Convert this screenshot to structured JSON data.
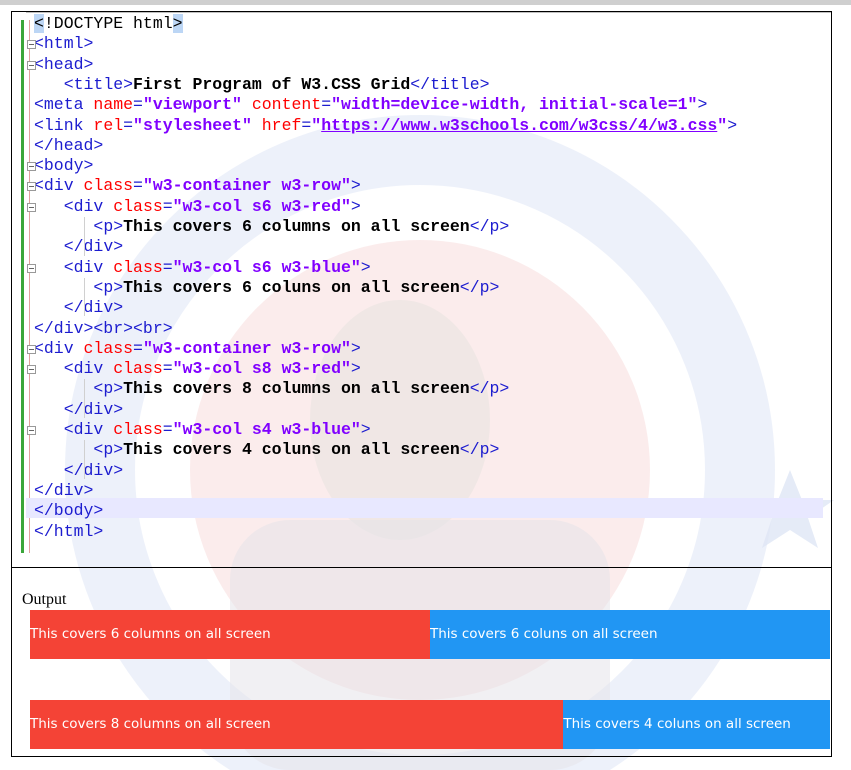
{
  "editor": {
    "lines": [
      {
        "kind": "doctype",
        "text": "<!DOCTYPE html>"
      },
      {
        "kind": "html_open",
        "text": "<html>"
      },
      {
        "kind": "head_open",
        "text": "<head>"
      },
      {
        "kind": "title",
        "open": "<title>",
        "content": "First Program of W3.CSS Grid",
        "close": "</title>"
      },
      {
        "kind": "meta",
        "tag": "<meta",
        "a1": "name",
        "v1": "\"viewport\"",
        "a2": "content",
        "v2": "\"width=device-width, initial-scale=1\"",
        "end": ">"
      },
      {
        "kind": "link",
        "tag": "<link",
        "a1": "rel",
        "v1": "\"stylesheet\"",
        "a2": "href",
        "v2q1": "\"",
        "href": "https://www.w3schools.com/w3css/4/w3.css",
        "v2q2": "\"",
        "end": ">"
      },
      {
        "kind": "head_close",
        "text": "</head>"
      },
      {
        "kind": "body_open",
        "text": "<body>"
      },
      {
        "kind": "div",
        "tag": "<div",
        "attr": "class",
        "val": "\"w3-container w3-row\"",
        "end": ">"
      },
      {
        "kind": "div",
        "tag": "<div",
        "attr": "class",
        "val": "\"w3-col s6 w3-red\"",
        "end": ">"
      },
      {
        "kind": "p",
        "open": "<p>",
        "content": "This covers 6 columns on all screen",
        "close": "</p>"
      },
      {
        "kind": "close",
        "text": "</div>"
      },
      {
        "kind": "div",
        "tag": "<div",
        "attr": "class",
        "val": "\"w3-col s6 w3-blue\"",
        "end": ">"
      },
      {
        "kind": "p",
        "open": "<p>",
        "content": "This covers 6 coluns on all screen",
        "close": "</p>"
      },
      {
        "kind": "close",
        "text": "</div>"
      },
      {
        "kind": "close",
        "text": "</div><br><br>"
      },
      {
        "kind": "div",
        "tag": "<div",
        "attr": "class",
        "val": "\"w3-container w3-row\"",
        "end": ">"
      },
      {
        "kind": "div",
        "tag": "<div",
        "attr": "class",
        "val": "\"w3-col s8 w3-red\"",
        "end": ">"
      },
      {
        "kind": "p",
        "open": "<p>",
        "content": "This covers 8 columns on all screen",
        "close": "</p>"
      },
      {
        "kind": "close",
        "text": "</div>"
      },
      {
        "kind": "div",
        "tag": "<div",
        "attr": "class",
        "val": "\"w3-col s4 w3-blue\"",
        "end": ">"
      },
      {
        "kind": "p",
        "open": "<p>",
        "content": "This covers 4 coluns on all screen",
        "close": "</p>"
      },
      {
        "kind": "close",
        "text": "</div>"
      },
      {
        "kind": "close",
        "text": "</div>"
      },
      {
        "kind": "close",
        "text": "</body>"
      },
      {
        "kind": "close",
        "text": "</html>"
      }
    ]
  },
  "output": {
    "label": "Output",
    "rows": [
      {
        "cols": [
          {
            "text": "This covers 6 columns on all screen",
            "span": 6,
            "color": "#f44336"
          },
          {
            "text": "This covers 6 coluns on all screen",
            "span": 6,
            "color": "#2196f3"
          }
        ]
      },
      {
        "cols": [
          {
            "text": "This covers 8 columns on all screen",
            "span": 8,
            "color": "#f44336"
          },
          {
            "text": "This covers 4 coluns on all screen",
            "span": 4,
            "color": "#2196f3"
          }
        ]
      }
    ]
  },
  "colors": {
    "tag": "#1c1ccf",
    "attr": "#ff0000",
    "value": "#8000ff",
    "gutter": "#3aa63a"
  }
}
